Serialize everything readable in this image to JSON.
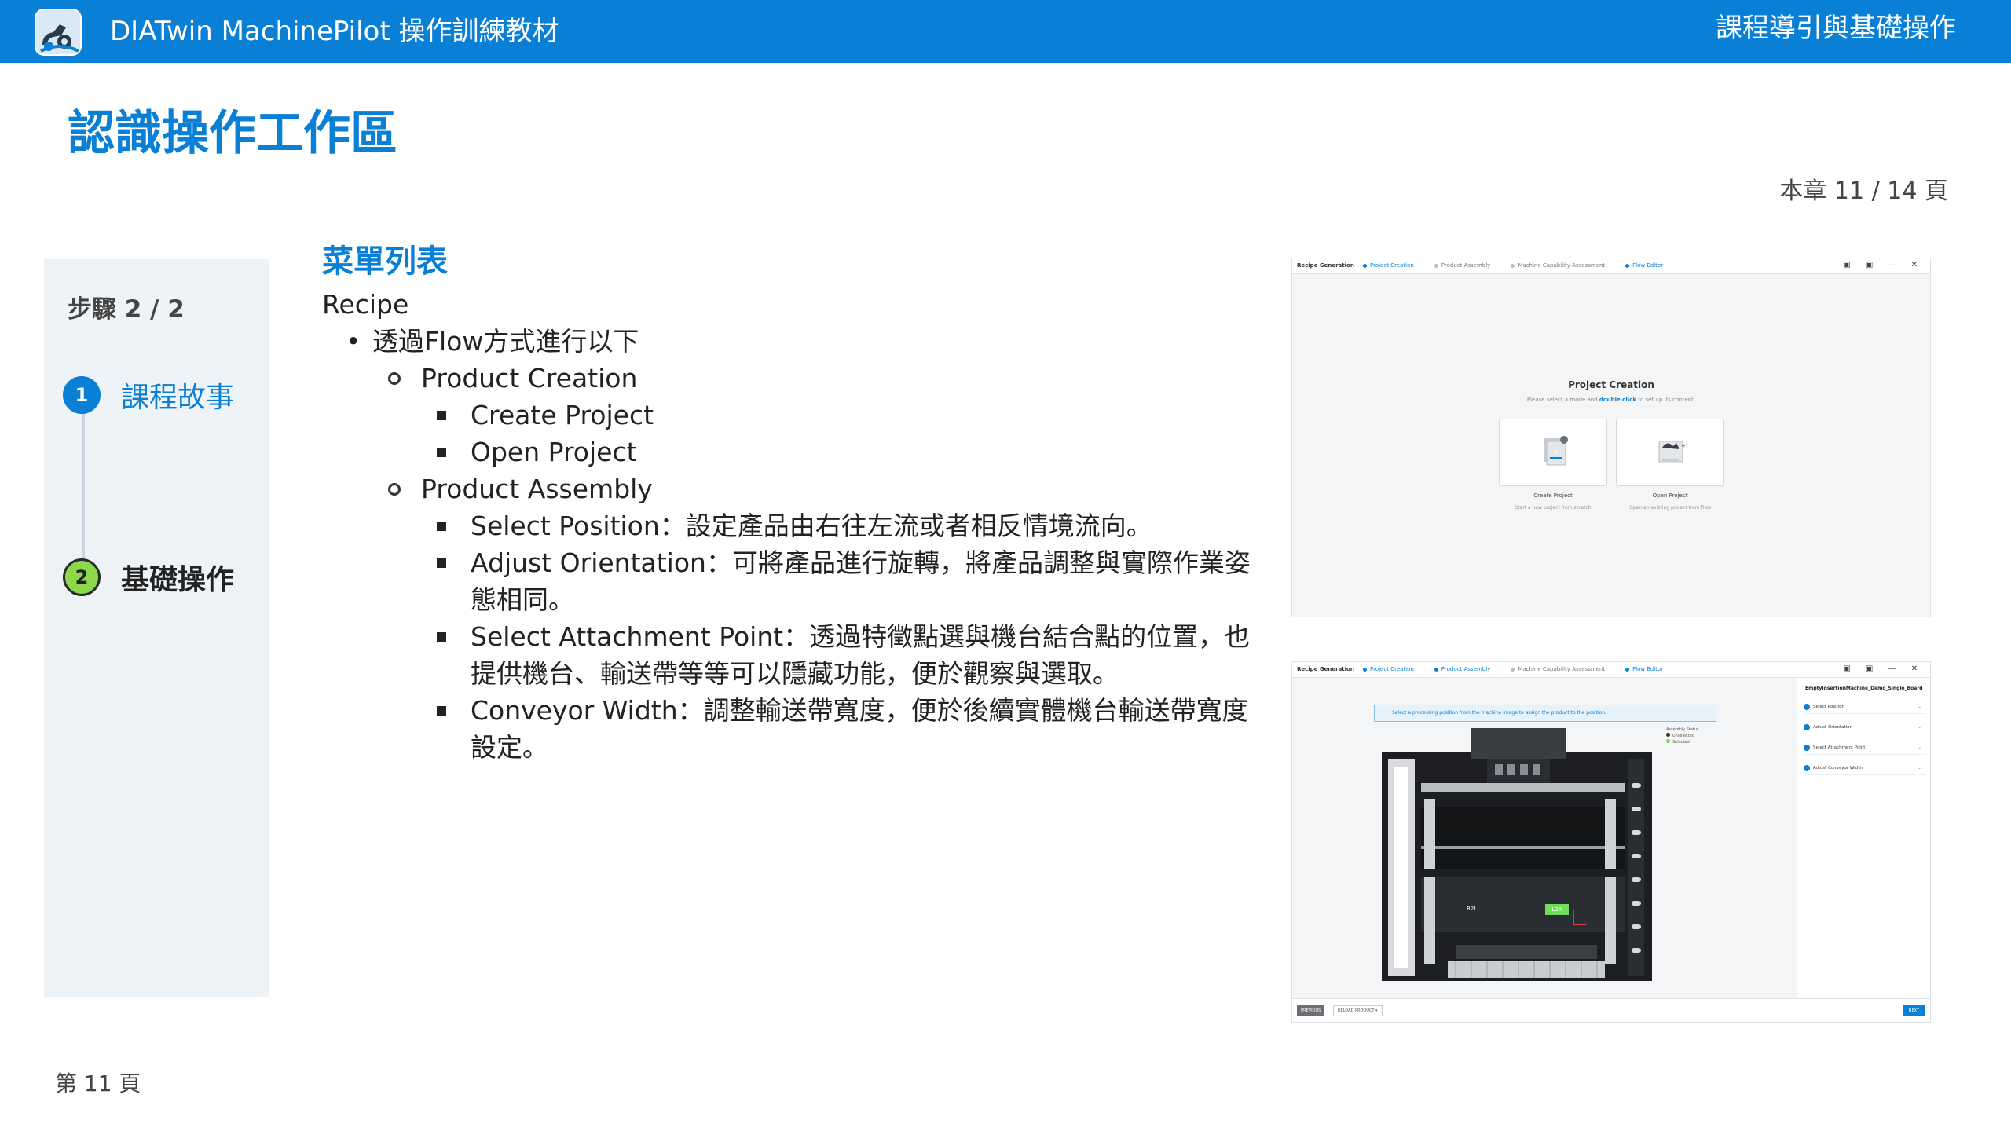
{
  "header": {
    "app_title": "DIATwin MachinePilot 操作訓練教材",
    "section": "課程導引與基礎操作"
  },
  "page": {
    "title": "認識操作工作區",
    "chapter_page": "本章 11 / 14 頁",
    "footer": "第 11 頁"
  },
  "steps": {
    "counter": "步驟 2 / 2",
    "items": [
      {
        "num": "1",
        "label": "課程故事"
      },
      {
        "num": "2",
        "label": "基礎操作"
      }
    ]
  },
  "content": {
    "heading": "菜單列表",
    "lines": [
      {
        "level": 0,
        "text": "Recipe"
      },
      {
        "level": 1,
        "text": "透過Flow方式進行以下"
      },
      {
        "level": 2,
        "text": "Product Creation"
      },
      {
        "level": 3,
        "text": "Create Project"
      },
      {
        "level": 3,
        "text": "Open Project"
      },
      {
        "level": 2,
        "text": "Product Assembly"
      },
      {
        "level": 3,
        "text": "Select Position：設定產品由右往左流或者相反情境流向。"
      },
      {
        "level": 3,
        "text": "Adjust Orientation：可將產品進行旋轉，將產品調整與實際作業姿態相同。"
      },
      {
        "level": 3,
        "text": "Select  Attachment Point：透過特徵點選與機台結合點的位置，也提供機台、輸送帶等等可以隱藏功能，便於觀察與選取。"
      },
      {
        "level": 3,
        "text": "Conveyor Width：調整輸送帶寬度，便於後續實體機台輸送帶寬度設定。"
      }
    ]
  },
  "screenshot_creation": {
    "app_label": "Recipe Generation",
    "tabs": [
      "Project Creation",
      "Product Assembly",
      "Machine Capability Assessment",
      "Flow Editor"
    ],
    "active_tab": "Project Creation",
    "window_controls": "▣ ▣ — ✕",
    "title": "Project Creation",
    "subtitle_pre": "Please select a mode and ",
    "subtitle_link": "double click",
    "subtitle_post": " to set up its content.",
    "card1_label": "Create Project",
    "card1_desc": "Start a new project from scratch",
    "card2_label": "Open Project",
    "card2_desc": "Open an existing project from files"
  },
  "screenshot_assembly": {
    "app_label": "Recipe Generation",
    "tabs": [
      "Project Creation",
      "Product Assembly",
      "Machine Capability Assessment",
      "Flow Editor"
    ],
    "active_tab": "Product Assembly",
    "window_controls": "▣ ▣ — ✕",
    "hint": "Select a processing position from the machine image to assign the product to the position.",
    "status_title": "Assembly Status",
    "status_unselected": "Unselected",
    "status_selected": "Selected",
    "product_name": "EmptyInsertionMachine_Demo_Single_Board",
    "side_items": [
      "Select Position",
      "Adjust Orientation",
      "Select Attachment Point",
      "Adjust  Conveyor Width"
    ],
    "tag_r2l": "R2L",
    "tag_l2r": "L2R",
    "btn_previous": "PREVIOUS",
    "btn_reload": "RELOAD PRODUCT ▾",
    "btn_next": "NEXT"
  },
  "colors": {
    "brand": "#0a7fd6",
    "step_done": "#0a7fd6",
    "step_active": "#8bd94a"
  },
  "icons": {
    "logo": "robot-arm-logo-icon",
    "step_bullet": "circle-number-icon"
  }
}
